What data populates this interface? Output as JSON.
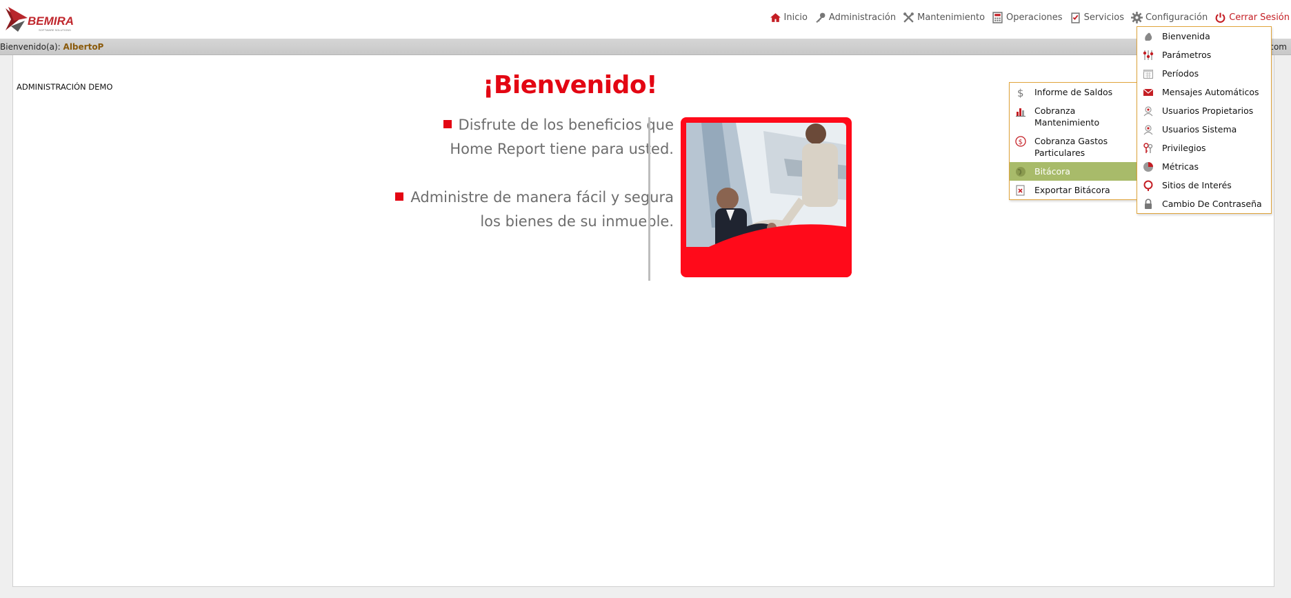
{
  "header": {
    "logo_text": "BEMIRA",
    "logo_tagline": "SOFTWARE SOLUTIONS",
    "nav": [
      {
        "label": "Inicio",
        "icon": "home-icon"
      },
      {
        "label": "Administración",
        "icon": "key-icon"
      },
      {
        "label": "Mantenimiento",
        "icon": "tools-icon"
      },
      {
        "label": "Operaciones",
        "icon": "calculator-icon"
      },
      {
        "label": "Servicios",
        "icon": "clipboard-icon"
      },
      {
        "label": "Configuración",
        "icon": "gear-icon"
      },
      {
        "label": "Cerrar Sesión",
        "icon": "power-icon"
      }
    ]
  },
  "welcome_bar": {
    "prefix": "Bienvenido(a):",
    "user": "AlbertoP",
    "right_snippet": "com"
  },
  "main": {
    "admin_title": "ADMINISTRACIÓN DEMO",
    "hero_title": "¡Bienvenido!",
    "bullet1_line1": "Disfrute de los beneficios que",
    "bullet1_line2": "Home Report tiene para usted.",
    "bullet2_line1": "Administre de manera fácil y segura",
    "bullet2_line2": "los bienes de su inmueble."
  },
  "config_menu": [
    {
      "label": "Bienvenida",
      "icon": "hand-icon"
    },
    {
      "label": "Parámetros",
      "icon": "sliders-icon"
    },
    {
      "label": "Períodos",
      "icon": "calendar-icon"
    },
    {
      "label": "Mensajes Automáticos",
      "icon": "envelope-icon"
    },
    {
      "label": "Usuarios Propietarios",
      "icon": "user-icon"
    },
    {
      "label": "Usuarios Sistema",
      "icon": "user-gear-icon"
    },
    {
      "label": "Privilegios",
      "icon": "keys-icon"
    },
    {
      "label": "Métricas",
      "icon": "pie-chart-icon"
    },
    {
      "label": "Sitios de Interés",
      "icon": "pin-icon"
    },
    {
      "label": "Cambio De Contraseña",
      "icon": "lock-icon"
    }
  ],
  "services_menu": [
    {
      "label": "Informe de Saldos",
      "icon": "dollar-icon"
    },
    {
      "label": "Cobranza Mantenimiento",
      "icon": "bar-chart-icon"
    },
    {
      "label": "Cobranza Gastos Particulares",
      "icon": "coin-icon"
    },
    {
      "label": "Bitácora",
      "icon": "globe-icon",
      "active": true
    },
    {
      "label": "Exportar Bitácora",
      "icon": "export-icon"
    }
  ],
  "colors": {
    "brand_red": "#e30613",
    "menu_border": "#e0a43a",
    "menu_active": "#a8bb6a",
    "user_name": "#8a5a0b"
  }
}
